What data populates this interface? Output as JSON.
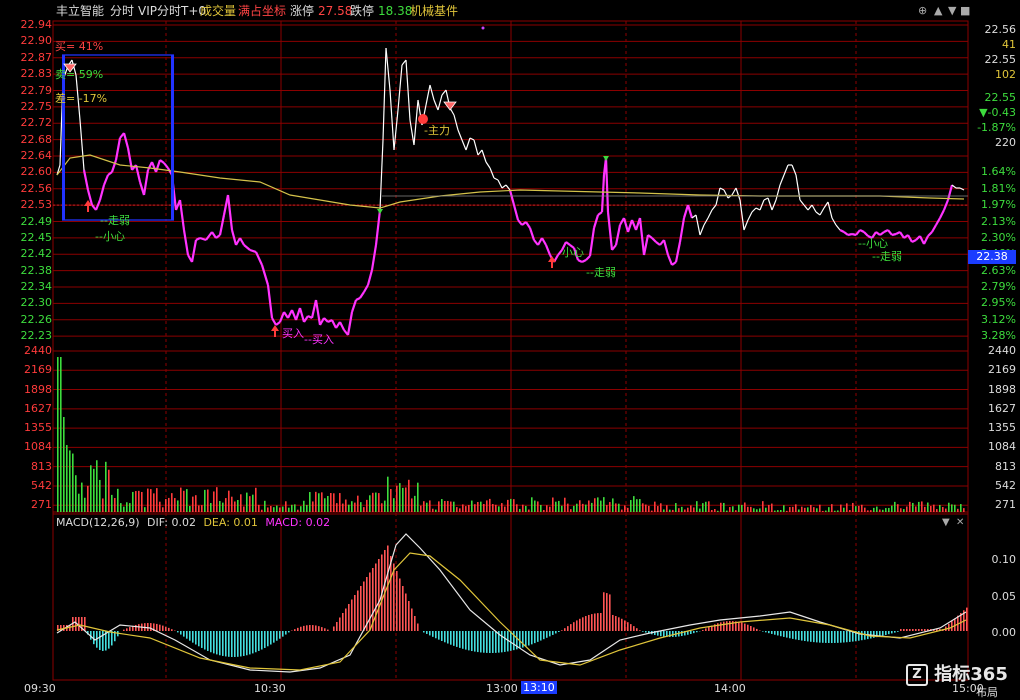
{
  "header": {
    "stock_name": "丰立智能",
    "mode": "分时",
    "vip_mode": "VIP分时T+0",
    "volume_label": "成交量",
    "full_coord_label": "满占坐标",
    "limit_up_label": "涨停",
    "limit_up_value": "27.58",
    "limit_down_label": "跌停",
    "limit_down_value": "18.38",
    "sector": "机械基件"
  },
  "price_axis": {
    "left_labels": [
      "22.94",
      "22.90",
      "22.87",
      "22.83",
      "22.79",
      "22.75",
      "22.72",
      "22.68",
      "22.64",
      "22.60",
      "22.56",
      "22.53",
      "22.49",
      "22.45",
      "22.42",
      "22.38",
      "22.34",
      "22.30",
      "22.26",
      "22.23"
    ],
    "right_pct_labels": [
      "1.64%",
      "1.81%",
      "1.97%",
      "2.13%",
      "2.30%",
      "2.46%",
      "2.63%",
      "2.79%",
      "2.95%",
      "3.12%",
      "3.28%"
    ],
    "current_price_tag": "22.38"
  },
  "quote_panel": {
    "price1": "22.56",
    "vol1": "41",
    "price2": "22.55",
    "vol2": "102",
    "last": "22.55",
    "change": "▼-0.43",
    "change_pct": "-1.87%",
    "volume": "220"
  },
  "volume_axis": {
    "labels": [
      "2440",
      "2169",
      "1898",
      "1627",
      "1355",
      "1084",
      "813",
      "542",
      "271"
    ]
  },
  "macd": {
    "title": "MACD(12,26,9)",
    "dif_label": "DIF:",
    "dif_value": "0.02",
    "dea_label": "DEA:",
    "dea_value": "0.01",
    "macd_label": "MACD:",
    "macd_value": "0.02",
    "axis": [
      "0.10",
      "0.05",
      "0.00"
    ]
  },
  "time_axis": {
    "labels": [
      "09:30",
      "10:30",
      "13:00",
      "13:10",
      "14:00",
      "15:00"
    ],
    "corner": "布局"
  },
  "annotations": {
    "buy_pct": "买= 41%",
    "sell_pct": "卖= 59%",
    "diff_pct": "差= -17%",
    "weak1": "--走弱",
    "careful1": "--小心",
    "buy_in1": "买入",
    "buy_in2": "--买入",
    "main_force": "-主力",
    "careful2": "小心",
    "weak2": "--走弱",
    "careful3": "--小心",
    "weak3": "--走弱"
  },
  "watermark": "指标365",
  "colors": {
    "bg": "#000000",
    "grid_red": "#8b0000",
    "price_up": "#ff3b3b",
    "price_down": "#3ddc3d",
    "price_line_strong": "#ff33ff",
    "price_line_normal": "#ffffff",
    "avg_line": "#d4c24a",
    "blue_bar": "#2233ff"
  }
}
